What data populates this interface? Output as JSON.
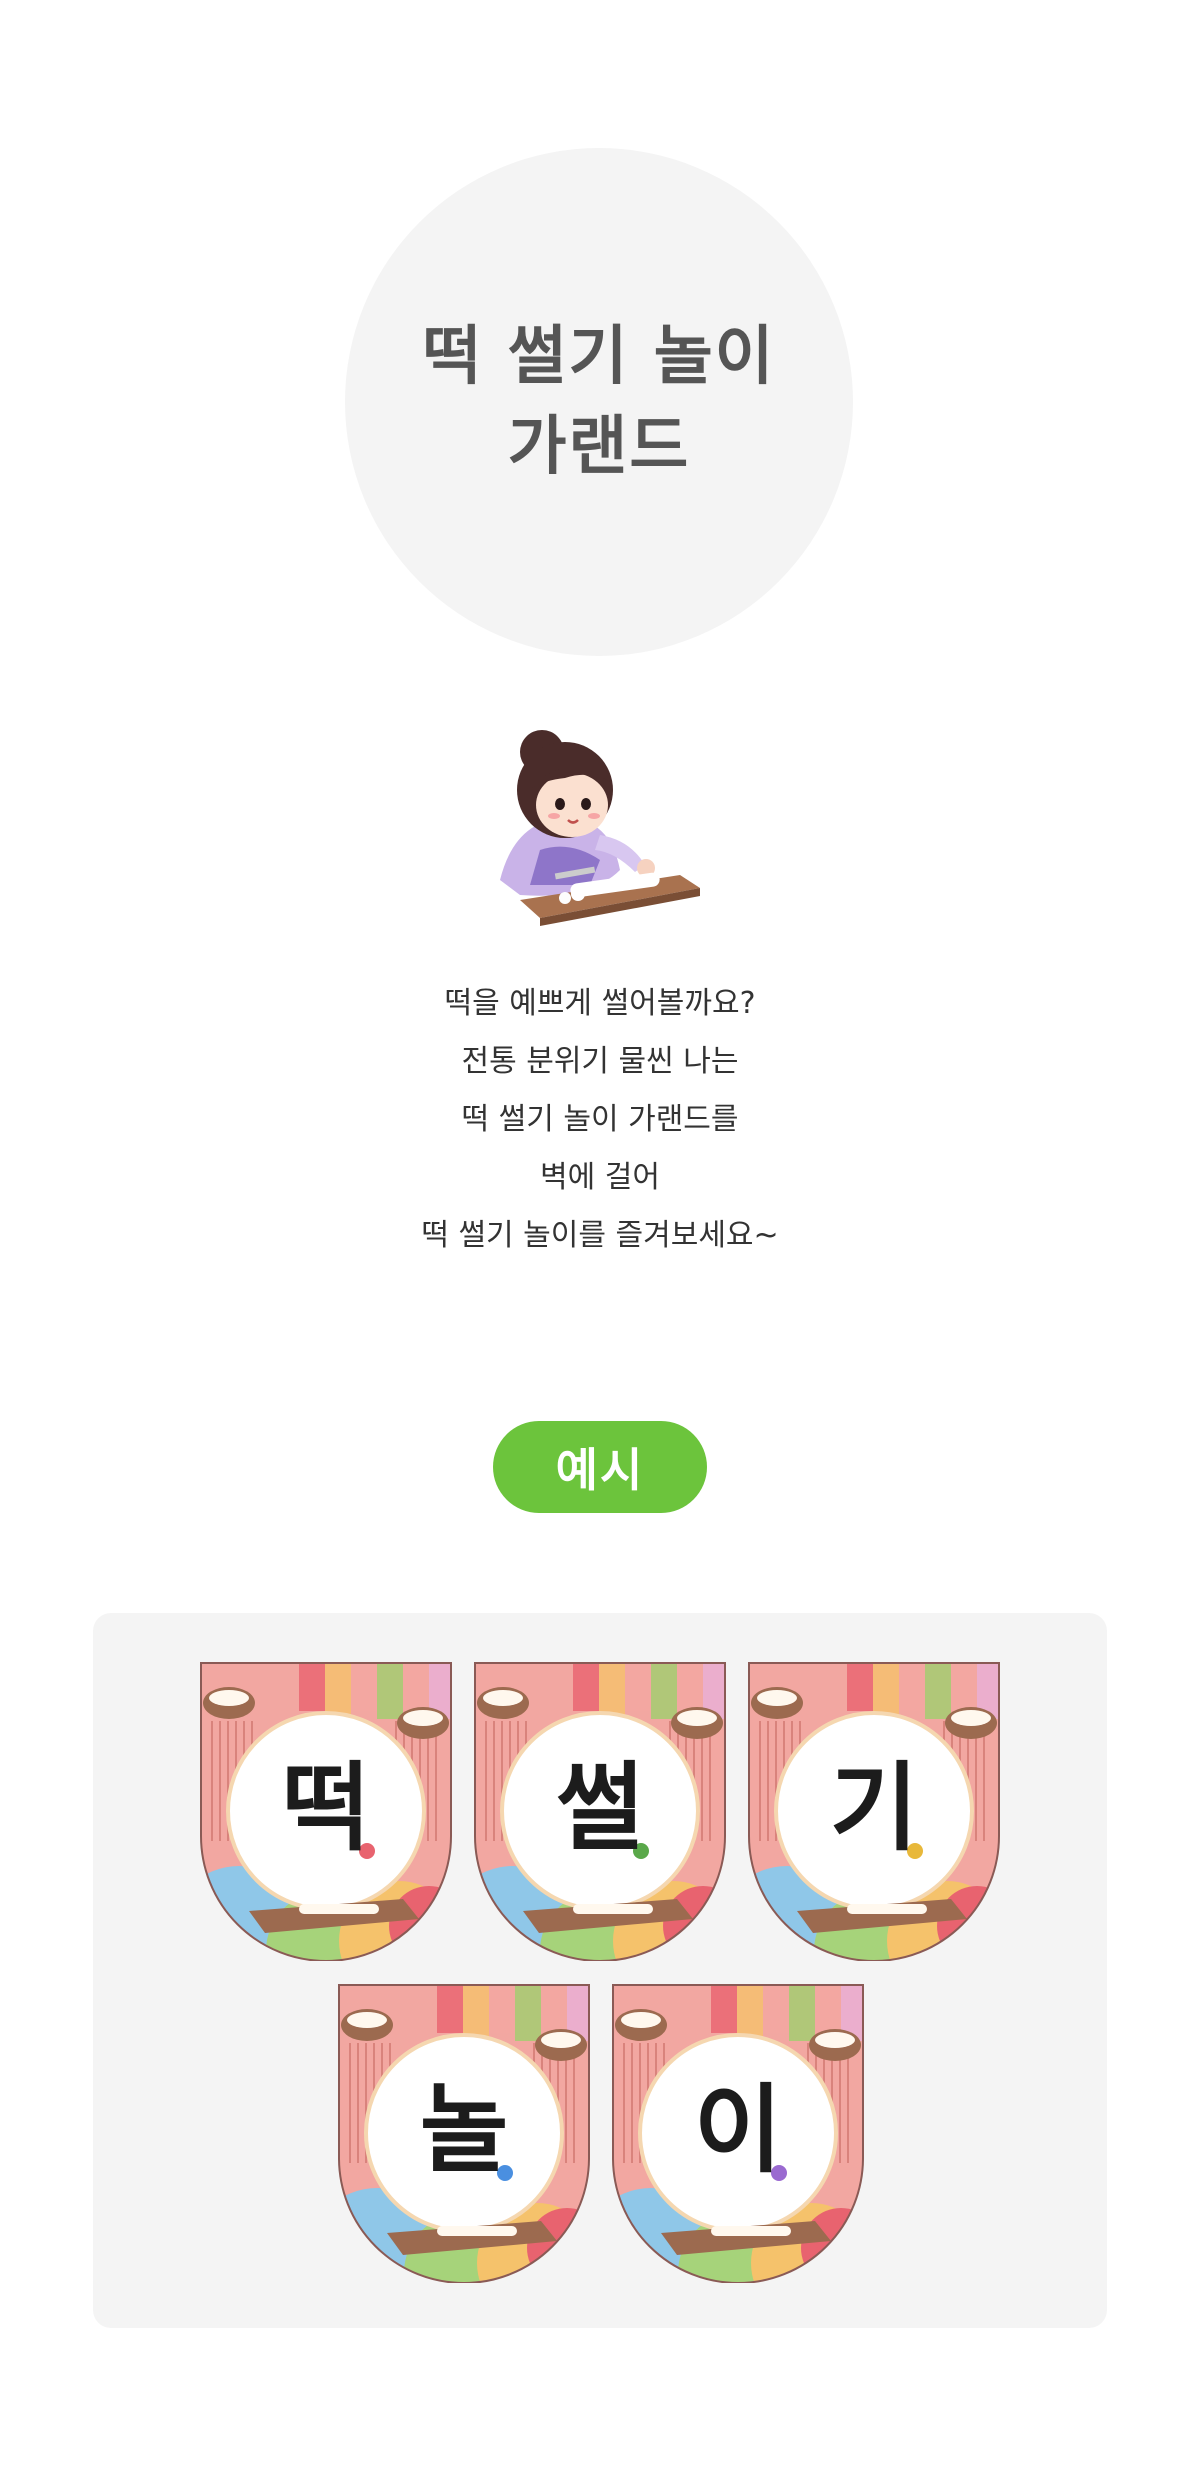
{
  "title": {
    "line1": "떡 썰기 놀이",
    "line2": "가랜드"
  },
  "description": {
    "lines": [
      "떡을 예쁘게 썰어볼까요?",
      "전통 분위기 물씬 나는",
      "떡 썰기 놀이 가랜드를",
      "벽에 걸어",
      "떡 썰기 놀이를 즐겨보세요~"
    ]
  },
  "example_label": "예시",
  "garland": {
    "flags": [
      {
        "char": "떡",
        "dot": "#e8636f"
      },
      {
        "char": "썰",
        "dot": "#5aa84a"
      },
      {
        "char": "기",
        "dot": "#e8b83a"
      },
      {
        "char": "놀",
        "dot": "#4a8fe0"
      },
      {
        "char": "이",
        "dot": "#9a6ad0"
      }
    ]
  },
  "colors": {
    "accent_green": "#6cc43c",
    "title_gray": "#555555",
    "flag_pink": "#f2a7a1",
    "panel_bg": "#f4f4f4"
  }
}
